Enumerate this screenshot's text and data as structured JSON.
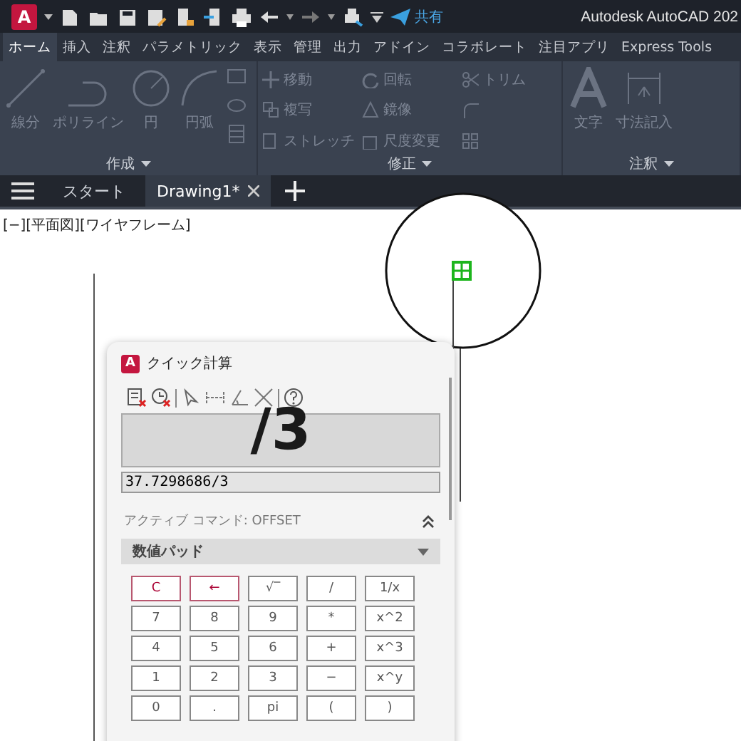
{
  "app": {
    "logo_letter": "A",
    "share_label": "共有",
    "title": "Autodesk AutoCAD 202"
  },
  "ribbon_tabs": [
    {
      "label": "ホーム",
      "selected": true
    },
    {
      "label": "挿入",
      "selected": false
    },
    {
      "label": "注釈",
      "selected": false
    },
    {
      "label": "パラメトリック",
      "selected": false
    },
    {
      "label": "表示",
      "selected": false
    },
    {
      "label": "管理",
      "selected": false
    },
    {
      "label": "出力",
      "selected": false
    },
    {
      "label": "アドイン",
      "selected": false
    },
    {
      "label": "コラボレート",
      "selected": false
    },
    {
      "label": "注目アプリ",
      "selected": false
    },
    {
      "label": "Express Tools",
      "selected": false
    }
  ],
  "ribbon_panels": [
    {
      "title": "作成",
      "tools": [
        {
          "kind": "large",
          "label": "線分"
        },
        {
          "kind": "large",
          "label": "ポリライン"
        },
        {
          "kind": "large",
          "label": "円"
        },
        {
          "kind": "large",
          "label": "円弧"
        }
      ]
    },
    {
      "title": "修正",
      "tools": [
        {
          "kind": "small",
          "label": "移動"
        },
        {
          "kind": "small",
          "label": "回転"
        },
        {
          "kind": "small",
          "label": "トリム"
        },
        {
          "kind": "small",
          "label": "複写"
        },
        {
          "kind": "small",
          "label": "鏡像"
        },
        {
          "kind": "small"
        },
        {
          "kind": "small",
          "label": "ストレッチ"
        },
        {
          "kind": "small",
          "label": "尺度変更"
        },
        {
          "kind": "small"
        }
      ]
    },
    {
      "title": "注釈",
      "tools": [
        {
          "kind": "large",
          "label": "文字"
        },
        {
          "kind": "large",
          "label": "寸法記入"
        }
      ]
    }
  ],
  "document_tabs": [
    {
      "label": "スタート",
      "selected": false,
      "closable": false
    },
    {
      "label": "Drawing1*",
      "selected": true,
      "closable": true
    }
  ],
  "viewport_label": "[−][平面図][ワイヤフレーム]",
  "quick_calc": {
    "logo_letter": "A",
    "title": "クイック計算",
    "display": "/3",
    "input": "37.7298686/3",
    "active_command": "アクティブ コマンド: OFFSET",
    "section": "数値パッド",
    "keys": [
      {
        "label": "C",
        "kind": "clear"
      },
      {
        "label": "←",
        "kind": "clear"
      },
      {
        "label": "√‾",
        "kind": "normal"
      },
      {
        "label": "/",
        "kind": "normal"
      },
      {
        "label": "1/x",
        "kind": "normal"
      },
      {
        "label": "7",
        "kind": "normal"
      },
      {
        "label": "8",
        "kind": "normal"
      },
      {
        "label": "9",
        "kind": "normal"
      },
      {
        "label": "*",
        "kind": "normal"
      },
      {
        "label": "x^2",
        "kind": "normal"
      },
      {
        "label": "4",
        "kind": "normal"
      },
      {
        "label": "5",
        "kind": "normal"
      },
      {
        "label": "6",
        "kind": "normal"
      },
      {
        "label": "+",
        "kind": "normal"
      },
      {
        "label": "x^3",
        "kind": "normal"
      },
      {
        "label": "1",
        "kind": "normal"
      },
      {
        "label": "2",
        "kind": "normal"
      },
      {
        "label": "3",
        "kind": "normal"
      },
      {
        "label": "−",
        "kind": "normal"
      },
      {
        "label": "x^y",
        "kind": "normal"
      },
      {
        "label": "0",
        "kind": "normal"
      },
      {
        "label": ".",
        "kind": "normal"
      },
      {
        "label": "pi",
        "kind": "normal"
      },
      {
        "label": "(",
        "kind": "normal"
      },
      {
        "label": ")",
        "kind": "normal"
      }
    ]
  }
}
